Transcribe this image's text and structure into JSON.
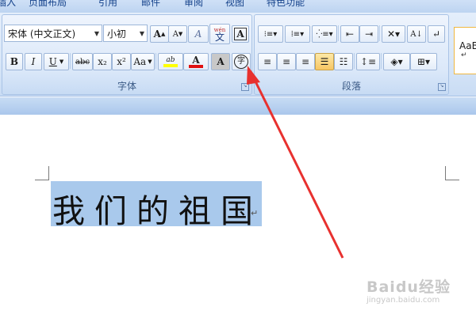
{
  "tabs": [
    "插入",
    "页面布局",
    "引用",
    "邮件",
    "审阅",
    "视图",
    "特色功能"
  ],
  "font_group": {
    "label": "字体",
    "font_name": "宋体 (中文正文)",
    "font_size": "小初",
    "grow_font": "A",
    "shrink_font": "A",
    "clear_format": "A",
    "phonetic": "wén",
    "phonetic_char": "文",
    "char_border": "A",
    "bold": "B",
    "italic": "I",
    "underline": "U",
    "strike": "abc",
    "subscript": "x₂",
    "superscript": "x²",
    "change_case": "Aa",
    "highlight": "ab",
    "font_color": "A",
    "char_shading": "A",
    "enclose_char": "字"
  },
  "paragraph_group": {
    "label": "段落"
  },
  "styles_group": {
    "sample": "AaB",
    "mark": "↵"
  },
  "document": {
    "text": "我们的祖国",
    "para_mark": "↵"
  },
  "watermark": {
    "brand": "Baidu经验",
    "url": "jingyan.baidu.com"
  },
  "colors": {
    "annotation_arrow": "#e8312f",
    "selection": "#a9c9ec",
    "highlight": "#ffff00",
    "font_color": "#e01010"
  }
}
